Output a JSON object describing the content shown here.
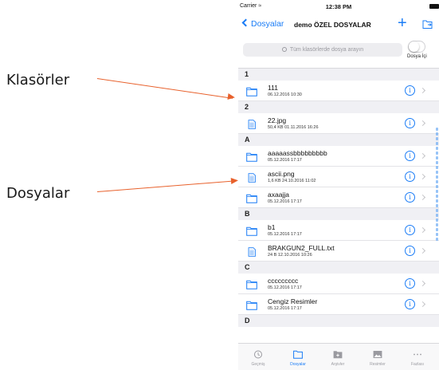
{
  "annotations": {
    "folders_label": "Klasörler",
    "files_label": "Dosyalar",
    "color": "#e8612c"
  },
  "status_bar": {
    "carrier": "Carrier",
    "time": "12:38 PM"
  },
  "nav": {
    "back_label": "Dosyalar",
    "title": "demo ÖZEL DOSYALAR",
    "plus": "+"
  },
  "search": {
    "placeholder": "Tüm klasörlerde dosya arayın",
    "toggle_label": "Dosya İçi",
    "toggle_on": false
  },
  "sections": [
    {
      "letter": "1",
      "items": [
        {
          "type": "folder",
          "name": "111",
          "meta": "06.12.2016 10:30"
        }
      ]
    },
    {
      "letter": "2",
      "items": [
        {
          "type": "file",
          "name": "22.jpg",
          "meta": "50,4 KB   01.11.2016 16:26"
        }
      ]
    },
    {
      "letter": "A",
      "items": [
        {
          "type": "folder",
          "name": "aaaaassbbbbbbbbb",
          "meta": "05.12.2016 17:17"
        },
        {
          "type": "file",
          "name": "ascii.png",
          "meta": "1,6 KB   24.10.2016 11:02"
        },
        {
          "type": "folder",
          "name": "axaajja",
          "meta": "05.12.2016 17:17"
        }
      ]
    },
    {
      "letter": "B",
      "items": [
        {
          "type": "folder",
          "name": "b1",
          "meta": "05.12.2016 17:17"
        },
        {
          "type": "file",
          "name": "BRAKGUN2_FULL.txt",
          "meta": "24 B   12.10.2016 10:26"
        }
      ]
    },
    {
      "letter": "C",
      "items": [
        {
          "type": "folder",
          "name": "ccccccccc",
          "meta": "05.12.2016 17:17"
        },
        {
          "type": "folder",
          "name": "Cengiz Resimler",
          "meta": "05.12.2016 17:17"
        }
      ]
    },
    {
      "letter": "D",
      "items": []
    }
  ],
  "info_glyph": "i",
  "tabs": [
    {
      "label": "Geçmiş",
      "icon": "clock-icon",
      "active": false
    },
    {
      "label": "Dosyalar",
      "icon": "folder-icon",
      "active": true
    },
    {
      "label": "Arşivler",
      "icon": "archive-icon",
      "active": false
    },
    {
      "label": "Resimler",
      "icon": "photos-icon",
      "active": false
    },
    {
      "label": "Fazlası",
      "icon": "more-icon",
      "active": false
    }
  ],
  "colors": {
    "accent": "#1a7cf6",
    "section_bg": "#f0f0f4",
    "separator": "#e3e3e7"
  }
}
